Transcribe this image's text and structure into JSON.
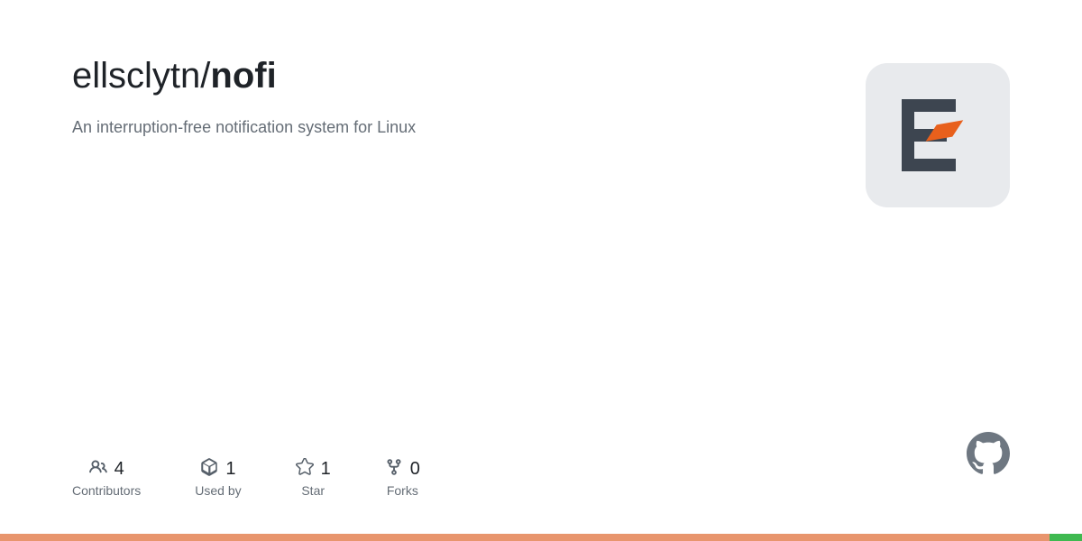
{
  "repo": {
    "owner": "ellsclytn",
    "name": "nofi",
    "description": "An interruption-free notification system for Linux"
  },
  "stats": [
    {
      "id": "contributors",
      "icon": "contributors-icon",
      "count": "4",
      "label": "Contributors"
    },
    {
      "id": "used-by",
      "icon": "package-icon",
      "count": "1",
      "label": "Used by"
    },
    {
      "id": "star",
      "icon": "star-icon",
      "count": "1",
      "label": "Star"
    },
    {
      "id": "forks",
      "icon": "fork-icon",
      "count": "0",
      "label": "Forks"
    }
  ],
  "colors": {
    "title": "#1f2328",
    "description": "#656d76",
    "stat_number": "#1f2328",
    "stat_label": "#656d76",
    "icon_color": "#57606a",
    "app_icon_bg": "#e8eaed",
    "bottom_bar_orange": "#e8956d",
    "bottom_bar_green": "#3fb950"
  }
}
